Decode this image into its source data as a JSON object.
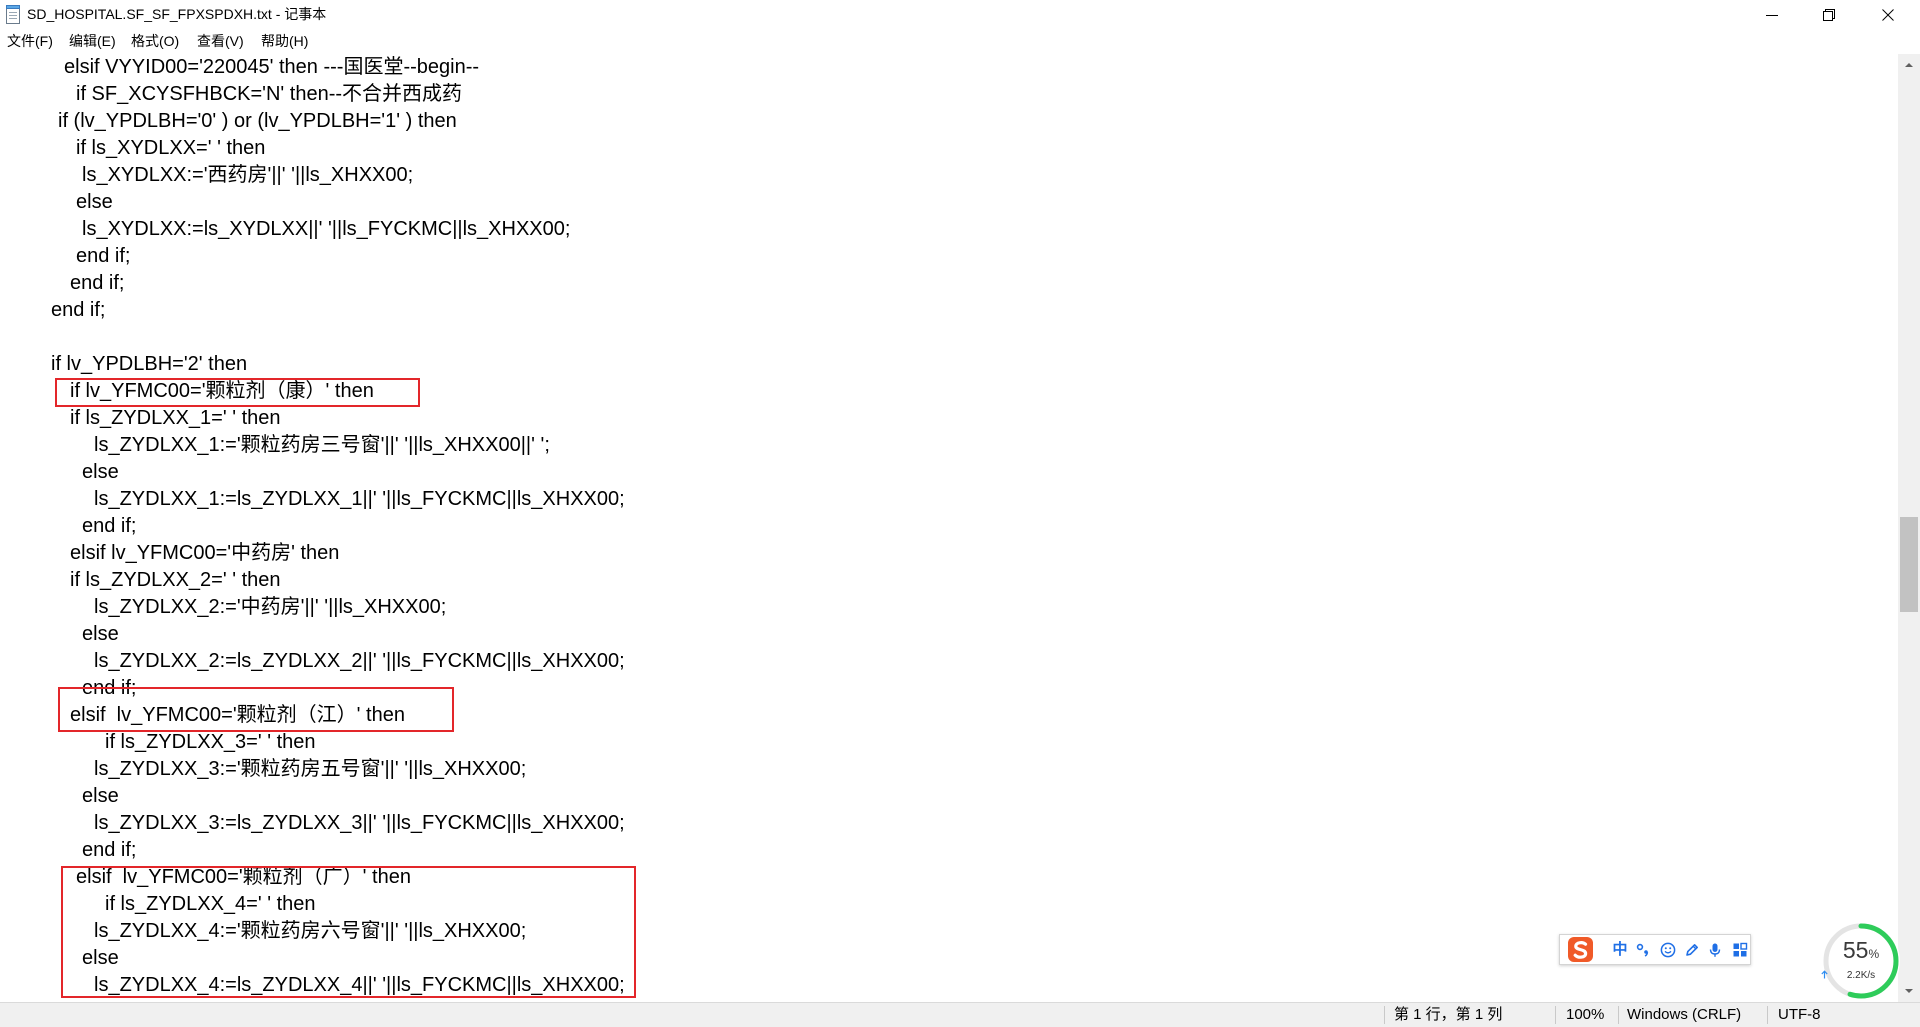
{
  "window": {
    "title": "SD_HOSPITAL.SF_SF_FPXSPDXH.txt - 记事本",
    "app_icon": "notepad-icon",
    "controls": [
      "minimize-icon",
      "restore-icon",
      "close-icon"
    ]
  },
  "menu": {
    "items": [
      "文件(F)",
      "编辑(E)",
      "格式(O)",
      "查看(V)",
      "帮助(H)"
    ]
  },
  "editor": {
    "lines": [
      "elsif VYYID00='220045' then ---国医堂--begin--",
      "if SF_XCYSFHBCK='N' then--不合并西成药",
      "if (lv_YPDLBH='0' ) or (lv_YPDLBH='1' ) then",
      "if ls_XYDLXX=' ' then",
      "ls_XYDLXX:='西药房'||' '||ls_XHXX00;",
      "else",
      "ls_XYDLXX:=ls_XYDLXX||' '||ls_FYCKMC||ls_XHXX00;",
      "end if;",
      "end if;",
      "end if;",
      "",
      "if lv_YPDLBH='2' then",
      "if lv_YFMC00='颗粒剂（康）' then",
      "if ls_ZYDLXX_1=' ' then",
      "ls_ZYDLXX_1:='颗粒药房三号窗'||' '||ls_XHXX00||' ';",
      "else",
      "ls_ZYDLXX_1:=ls_ZYDLXX_1||' '||ls_FYCKMC||ls_XHXX00;",
      "end if;",
      "elsif lv_YFMC00='中药房' then",
      "if ls_ZYDLXX_2=' ' then",
      "ls_ZYDLXX_2:='中药房'||' '||ls_XHXX00;",
      "else",
      "ls_ZYDLXX_2:=ls_ZYDLXX_2||' '||ls_FYCKMC||ls_XHXX00;",
      "end if;",
      "elsif  lv_YFMC00='颗粒剂（江）' then",
      "if ls_ZYDLXX_3=' ' then",
      "ls_ZYDLXX_3:='颗粒药房五号窗'||' '||ls_XHXX00;",
      "else",
      "ls_ZYDLXX_3:=ls_ZYDLXX_3||' '||ls_FYCKMC||ls_XHXX00;",
      "end if;",
      "elsif  lv_YFMC00='颗粒剂（广）' then",
      "if ls_ZYDLXX_4=' ' then",
      "ls_ZYDLXX_4:='颗粒药房六号窗'||' '||ls_XHXX00;",
      "else",
      "ls_ZYDLXX_4:=ls_ZYDLXX_4||' '||ls_FYCKMC||ls_XHXX00;"
    ]
  },
  "status_bar": {
    "cursor_position": "第 1 行，第 1 列",
    "zoom": "100%",
    "line_ending": "Windows (CRLF)",
    "encoding": "UTF-8"
  },
  "ime_toolbar": {
    "logo": "sogou-logo",
    "mode_label": "中",
    "icons": [
      "chinese-punctuation-icon",
      "emoji-icon",
      "skin-pen-icon",
      "microphone-icon",
      "toolbox-icon"
    ]
  },
  "net_monitor": {
    "percent": "55",
    "percent_unit": "%",
    "level": 0.55,
    "upload_icon": "upload-arrow-icon",
    "upload_speed": "2.2K/s"
  },
  "colors": {
    "annotation_red": "#e3262a",
    "ime_blue": "#1f6fe6",
    "sogou_orange": "#f05a28",
    "net_arc_green": "#2ecc5a",
    "scroll_thumb": "#c2c2c2"
  }
}
